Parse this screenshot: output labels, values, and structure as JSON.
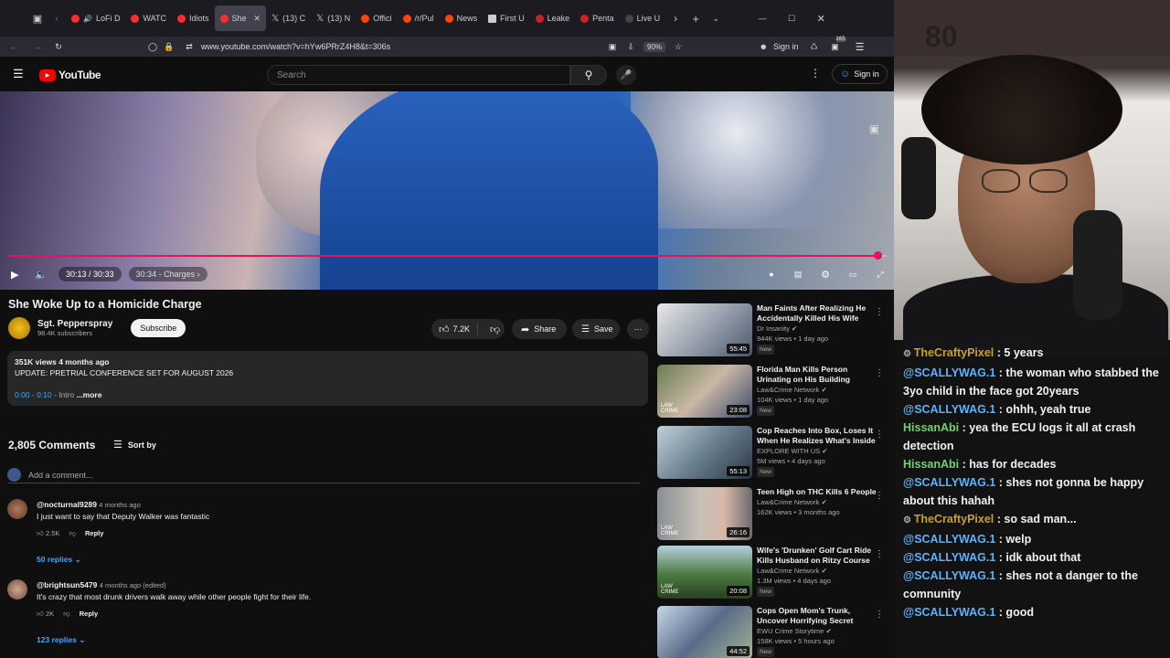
{
  "browser": {
    "tabs": [
      {
        "label": "LoFi D",
        "color": "#ff2d2d"
      },
      {
        "label": "WATC",
        "color": "#ff2d2d"
      },
      {
        "label": "Idiots",
        "color": "#ff2d2d"
      },
      {
        "label": "She",
        "color": "#ff2d2d",
        "active": true
      },
      {
        "label": "(13) C",
        "color": "#ffffff"
      },
      {
        "label": "(13) N",
        "color": "#ffffff"
      },
      {
        "label": "Offici",
        "color": "#ff4500"
      },
      {
        "label": "/r/Pul",
        "color": "#ff4500"
      },
      {
        "label": "News",
        "color": "#ff4500"
      },
      {
        "label": "First U",
        "color": "#cccccc"
      },
      {
        "label": "Leake",
        "color": "#cc2222"
      },
      {
        "label": "Penta",
        "color": "#cc2222"
      },
      {
        "label": "Live U",
        "color": "#444444"
      }
    ],
    "url": "www.youtube.com/watch?v=hYw6PRrZ4H8&t=306s",
    "zoom": "90%",
    "sign_in": "Sign in",
    "badge_count": "165"
  },
  "youtube": {
    "logo": "YouTube",
    "search_placeholder": "Search",
    "sign_in": "Sign in"
  },
  "player": {
    "time": "30:13 / 30:33",
    "chapter": "30:34 - Charges",
    "progress": 0.99
  },
  "video": {
    "title": "She Woke Up to a Homicide Charge",
    "channel": "Sgt. Pepperspray",
    "subscribers": "98.4K subscribers",
    "subscribe": "Subscribe",
    "likes": "7.2K",
    "share": "Share",
    "save": "Save",
    "views_date": "351K views  4 months ago",
    "description": "UPDATE: PRETRIAL CONFERENCE SET FOR AUGUST 2026",
    "chapter_link": "0:00 - 0:10",
    "chapter_text": " - Intro",
    "more": "...more"
  },
  "comments": {
    "count": "2,805 Comments",
    "sort": "Sort by",
    "add_placeholder": "Add a comment...",
    "items": [
      {
        "user": "@nocturnal9289",
        "time": "4 months ago",
        "text": "I just want to say that Deputy Walker was fantastic",
        "likes": "2.5K",
        "reply": "Reply",
        "replies": "50 replies"
      },
      {
        "user": "@brightsun5479",
        "time": "4 months ago (edited)",
        "text": "It's crazy that most drunk drivers walk away while other people fight for their life.",
        "likes": "2K",
        "reply": "Reply",
        "replies": "123 replies"
      }
    ]
  },
  "recommendations": [
    {
      "title": "Man Faints After Realizing He Accidentally Killed His Wife",
      "channel": "Dr Insanity",
      "meta": "944K views • 1 day ago",
      "duration": "55:45",
      "new": "New"
    },
    {
      "title": "Florida Man Kills Person Urinating on His Building",
      "channel": "Law&Crime Network",
      "meta": "104K views • 1 day ago",
      "duration": "23:08",
      "new": "New"
    },
    {
      "title": "Cop Reaches Into Box, Loses It When He Realizes What's Inside",
      "channel": "EXPLORE WITH US",
      "meta": "5M views • 4 days ago",
      "duration": "55:13",
      "new": "New"
    },
    {
      "title": "Teen High on THC Kills 6 People",
      "channel": "Law&Crime Network",
      "meta": "162K views • 3 months ago",
      "duration": "26:16",
      "new": ""
    },
    {
      "title": "Wife's 'Drunken' Golf Cart Ride Kills Husband on Ritzy Course",
      "channel": "Law&Crime Network",
      "meta": "1.3M views • 4 days ago",
      "duration": "20:08",
      "new": "New"
    },
    {
      "title": "Cops Open Mom's Trunk, Uncover Horrifying Secret",
      "channel": "EWU Crime Storytime",
      "meta": "158K views • 5 hours ago",
      "duration": "44:52",
      "new": "New"
    }
  ],
  "chat": [
    {
      "user": "TheCraftyPixel",
      "text": " : 5 years",
      "style": "u1",
      "badge": true
    },
    {
      "user": "@SCALLYWAG.1",
      "text": " : the woman who stabbed the 3yo child in the face got 20years",
      "style": "u2",
      "badge": false
    },
    {
      "user": "@SCALLYWAG.1",
      "text": " : ohhh, yeah true",
      "style": "u2",
      "badge": false
    },
    {
      "user": "HissanAbi",
      "text": " : yea the ECU logs it all at crash detection",
      "style": "u3",
      "badge": false
    },
    {
      "user": "HissanAbi",
      "text": " : has for decades",
      "style": "u3",
      "badge": false
    },
    {
      "user": "@SCALLYWAG.1",
      "text": " : shes not gonna be happy about this hahah",
      "style": "u2",
      "badge": false
    },
    {
      "user": "TheCraftyPixel",
      "text": " : so sad man...",
      "style": "u1",
      "badge": true
    },
    {
      "user": "@SCALLYWAG.1",
      "text": " : welp",
      "style": "u2",
      "badge": false
    },
    {
      "user": "@SCALLYWAG.1",
      "text": " : idk about that",
      "style": "u2",
      "badge": false
    },
    {
      "user": "@SCALLYWAG.1",
      "text": " : shes not a danger to the comnunity",
      "style": "u2",
      "badge": false
    },
    {
      "user": "@SCALLYWAG.1",
      "text": " : good",
      "style": "u2",
      "badge": false
    }
  ]
}
